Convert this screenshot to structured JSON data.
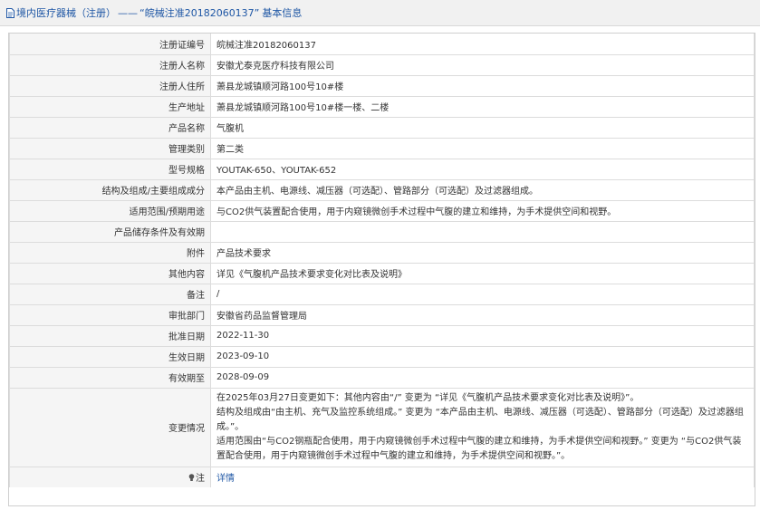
{
  "header": {
    "title": "境内医疗器械（注册）",
    "dash": "——",
    "reg_number_quoted": "“皖械注准20182060137”",
    "suffix": "基本信息"
  },
  "rows": [
    {
      "label": "注册证编号",
      "value": "皖械注准20182060137"
    },
    {
      "label": "注册人名称",
      "value": "安徽尤泰克医疗科技有限公司"
    },
    {
      "label": "注册人住所",
      "value": "萧县龙城镇顺河路100号10#楼"
    },
    {
      "label": "生产地址",
      "value": "萧县龙城镇顺河路100号10#楼一楼、二楼"
    },
    {
      "label": "产品名称",
      "value": "气腹机"
    },
    {
      "label": "管理类别",
      "value": "第二类"
    },
    {
      "label": "型号规格",
      "value": "YOUTAK-650、YOUTAK-652"
    },
    {
      "label": "结构及组成/主要组成成分",
      "value": "本产品由主机、电源线、减压器（可选配）、管路部分（可选配）及过滤器组成。"
    },
    {
      "label": "适用范围/预期用途",
      "value": "与CO2供气装置配合使用，用于内窥镜微创手术过程中气腹的建立和维持，为手术提供空间和视野。"
    },
    {
      "label": "产品储存条件及有效期",
      "value": ""
    },
    {
      "label": "附件",
      "value": "产品技术要求"
    },
    {
      "label": "其他内容",
      "value": "详见《气腹机产品技术要求变化对比表及说明》"
    },
    {
      "label": "备注",
      "value": "/"
    },
    {
      "label": "审批部门",
      "value": "安徽省药品监督管理局"
    },
    {
      "label": "批准日期",
      "value": "2022-11-30"
    },
    {
      "label": "生效日期",
      "value": "2023-09-10"
    },
    {
      "label": "有效期至",
      "value": "2028-09-09"
    }
  ],
  "change": {
    "label": "变更情况",
    "lines": [
      "在2025年03月27日变更如下：其他内容由“/” 变更为 “详见《气腹机产品技术要求变化对比表及说明》”。",
      "结构及组成由“由主机、充气及监控系统组成。” 变更为 “本产品由主机、电源线、减压器（可选配）、管路部分（可选配）及过滤器组成。”。",
      "适用范围由“与CO2钢瓶配合使用，用于内窥镜微创手术过程中气腹的建立和维持，为手术提供空间和视野。” 变更为 “与CO2供气装置配合使用，用于内窥镜微创手术过程中气腹的建立和维持，为手术提供空间和视野。”。"
    ]
  },
  "note": {
    "label": "注",
    "link": "详情"
  },
  "colors": {
    "header_text": "#1f57a5",
    "label_bg": "#f5f5f5",
    "border": "#dcdcdc",
    "link": "#1f57a5"
  },
  "icons": [
    "document-icon",
    "lightbulb-icon"
  ]
}
